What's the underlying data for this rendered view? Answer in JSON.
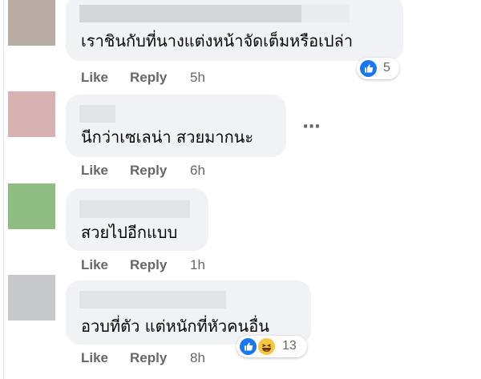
{
  "colors": {
    "bubble": "#f0f2f5",
    "action_text": "#65676b",
    "like_blue": "#1877f2",
    "haha_yellow": "#f7c641"
  },
  "comments": [
    {
      "avatar_color": "#b8aca4",
      "text": "เราชินกับที่นางแต่งหน้าจัดเต็มหรือเปล่า",
      "actions": {
        "like": "Like",
        "reply": "Reply",
        "time": "5h"
      },
      "reactions": {
        "types": [
          "like-icon"
        ],
        "count": "5"
      }
    },
    {
      "avatar_color": "#d7b2b3",
      "text": "นีกว่าเซเลน่า สวยมากนะ",
      "actions": {
        "like": "Like",
        "reply": "Reply",
        "time": "6h"
      },
      "more_label": "···"
    },
    {
      "avatar_color": "#8fbc81",
      "text": "สวยไปอีกแบบ",
      "actions": {
        "like": "Like",
        "reply": "Reply",
        "time": "1h"
      }
    },
    {
      "avatar_color": "#c7c8cb",
      "text": "อวบที่ตัว แต่หนักที่หัวคนอื่น",
      "actions": {
        "like": "Like",
        "reply": "Reply",
        "time": "8h"
      },
      "reactions": {
        "types": [
          "like-icon",
          "haha-icon"
        ],
        "count": "13"
      }
    }
  ]
}
